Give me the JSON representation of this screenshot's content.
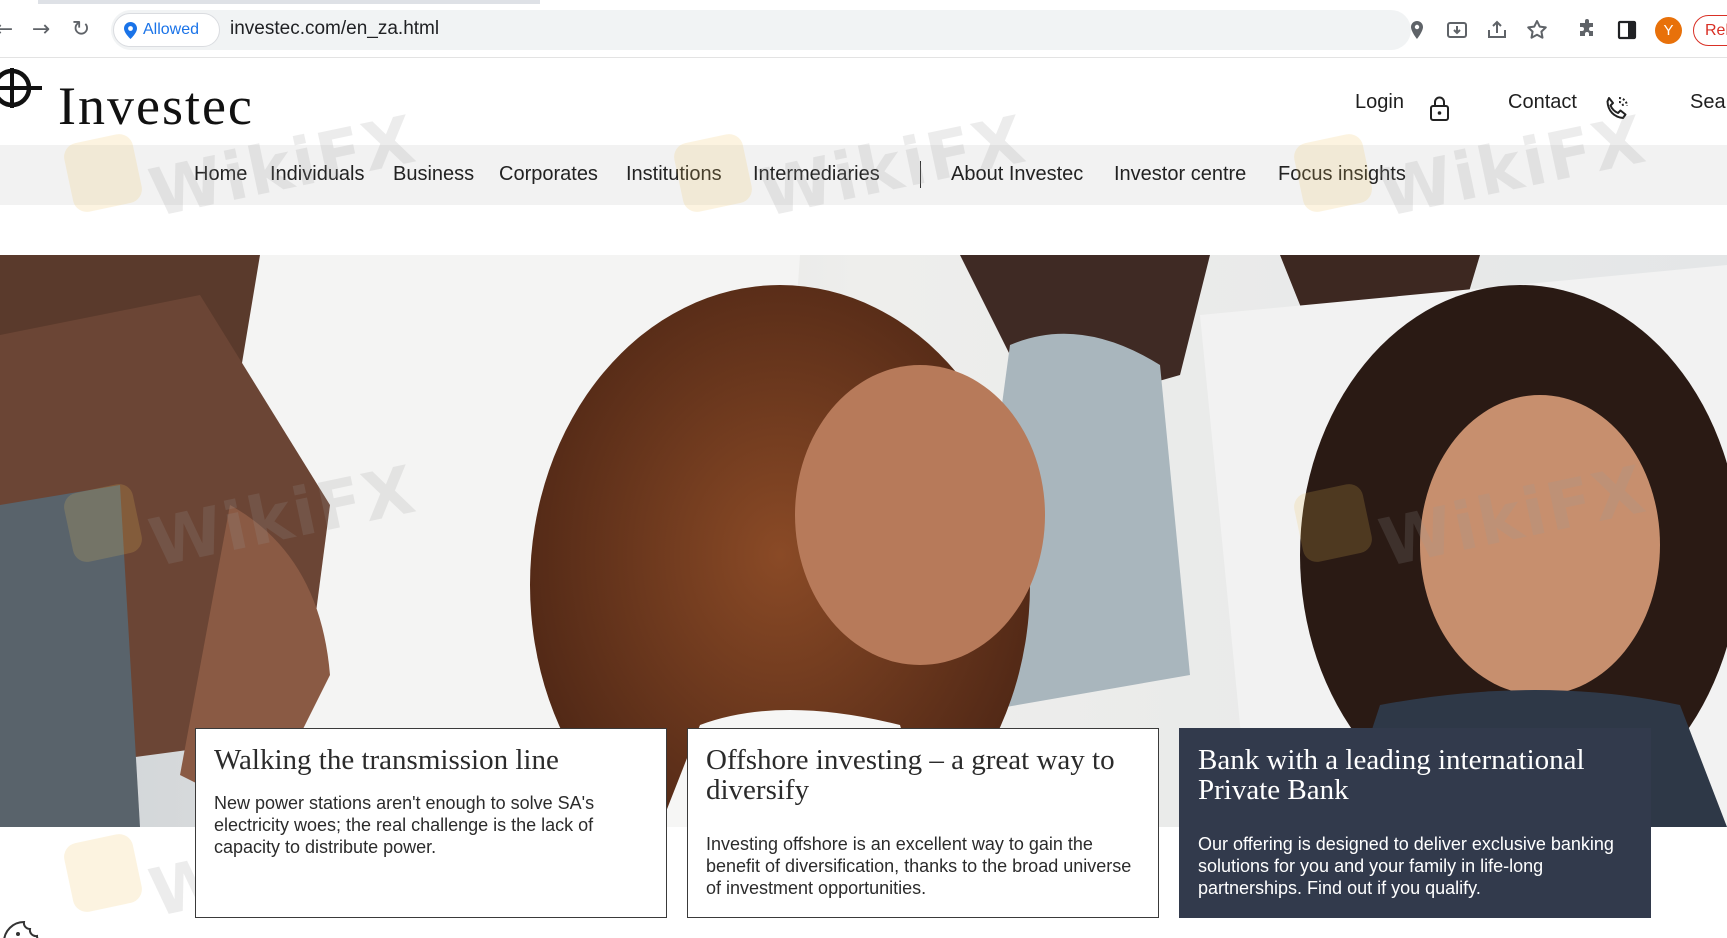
{
  "browser": {
    "permission_label": "Allowed",
    "url": "investec.com/en_za.html",
    "avatar_letter": "Y",
    "relaunch_label": "Rel",
    "icons": [
      "back-icon",
      "forward-icon",
      "reload-icon",
      "location-icon",
      "install-icon",
      "share-icon",
      "bookmark-star-icon",
      "extensions-icon",
      "side-panel-icon"
    ]
  },
  "header": {
    "brand": "Investec",
    "login_label": "Login",
    "contact_label": "Contact",
    "search_label": "Sea"
  },
  "nav": {
    "items": [
      {
        "label": "Home"
      },
      {
        "label": "Individuals"
      },
      {
        "label": "Business"
      },
      {
        "label": "Corporates"
      },
      {
        "label": "Institutions"
      },
      {
        "label": "Intermediaries"
      },
      {
        "label": "About Investec"
      },
      {
        "label": "Investor centre"
      },
      {
        "label": "Focus insights"
      }
    ]
  },
  "cards": [
    {
      "title": "Walking the transmission line",
      "body": "New power stations aren't enough to solve SA's electricity woes; the real challenge is the lack of capacity to distribute power."
    },
    {
      "title": "Offshore investing – a great way to diversify",
      "body": "Investing offshore is an excellent way to gain the benefit of diversification, thanks to the broad universe of investment opportunities."
    },
    {
      "title": "Bank with a leading international Private Bank",
      "body": "Our offering is designed to deliver exclusive banking solutions for you and your family in life-long partnerships. Find out if you qualify."
    }
  ],
  "watermark": "WikiFX",
  "colors": {
    "dark_card": "#323a4c",
    "nav_bg": "#f2f2f2",
    "permission_blue": "#1a73e8",
    "avatar_orange": "#e8710a",
    "relaunch_red": "#d93025"
  }
}
